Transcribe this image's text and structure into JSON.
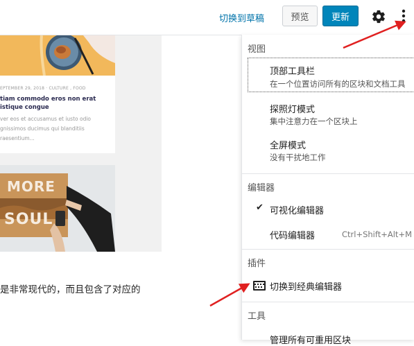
{
  "topbar": {
    "switch_draft": "切换到草稿",
    "preview": "预览",
    "update": "更新"
  },
  "content": {
    "card1_meta": "EPTEMBER 29, 2018 · CULTURE , FOOD",
    "card1_title_line1": "tiam commodo eros non erat",
    "card1_title_line2": "istique congue",
    "card1_text_line1": "ver eos et accusamus et iusto odio",
    "card1_text_line2": "gnissimos ducimus qui blanditiis",
    "card1_text_line3": "raesentium...",
    "card2_sign_top": "MORE",
    "card2_sign_bottom": "SOUL",
    "bottom_text": "是非常现代的，而且包含了对应的"
  },
  "menu": {
    "view_title": "视图",
    "top_toolbar": "顶部工具栏",
    "top_toolbar_desc": "在一个位置访问所有的区块和文档工具",
    "spotlight": "探照灯模式",
    "spotlight_desc": "集中注意力在一个区块上",
    "fullscreen": "全屏模式",
    "fullscreen_desc": "没有干扰地工作",
    "editor_title": "编辑器",
    "visual_editor": "可视化编辑器",
    "code_editor": "代码编辑器",
    "code_editor_shortcut": "Ctrl+Shift+Alt+M",
    "plugins_title": "插件",
    "classic_editor": "切换到经典编辑器",
    "tools_title": "工具",
    "manage_blocks": "管理所有可重用区块"
  },
  "colors": {
    "accent": "#0085ba",
    "link": "#0073aa",
    "arrow": "#e02020"
  },
  "icons": [
    "gear-icon",
    "more-vertical-icon",
    "checkmark-icon",
    "keyboard-icon"
  ]
}
